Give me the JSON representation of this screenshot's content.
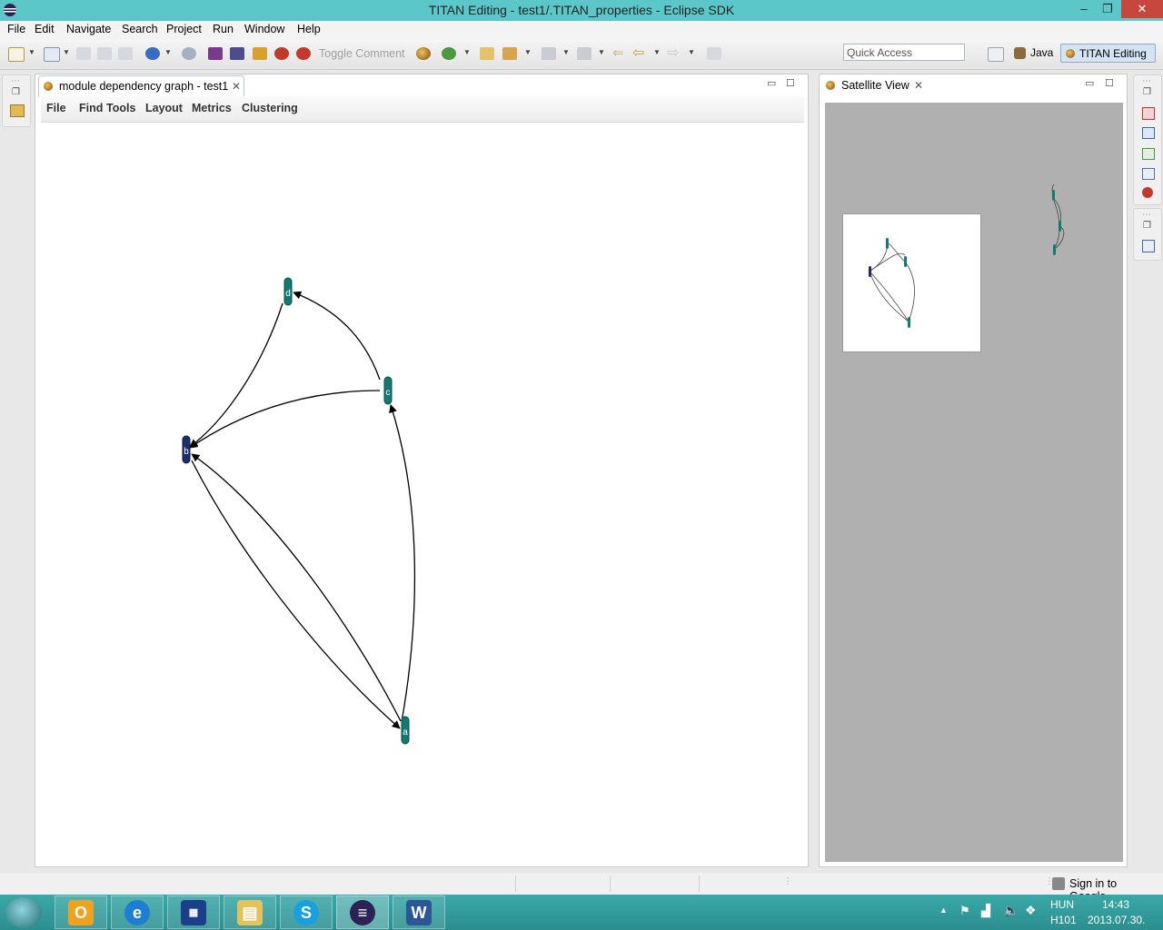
{
  "window": {
    "title": "TITAN Editing - test1/.TITAN_properties - Eclipse SDK",
    "minimize": "‒",
    "restore": "❐",
    "close": "✕"
  },
  "menubar": {
    "items": [
      "File",
      "Edit",
      "Navigate",
      "Search",
      "Project",
      "Run",
      "Window",
      "Help"
    ]
  },
  "toolbar": {
    "toggle_comment": "Toggle Comment",
    "quick_access_placeholder": "Quick Access",
    "perspectives": [
      "Java",
      "TITAN Editing"
    ]
  },
  "editor": {
    "tab_title": "module dependency graph - test1",
    "menu": [
      "File",
      "Find",
      "Tools",
      "Layout",
      "Metrics",
      "Clustering"
    ],
    "graph": {
      "nodes": [
        {
          "label": "d"
        },
        {
          "label": "c"
        },
        {
          "label": "b"
        },
        {
          "label": "a"
        }
      ],
      "edges": [
        {
          "from": "c",
          "to": "d"
        },
        {
          "from": "c",
          "to": "b"
        },
        {
          "from": "a",
          "to": "c"
        },
        {
          "from": "b",
          "to": "a"
        },
        {
          "from": "a",
          "to": "b"
        },
        {
          "from": "d",
          "to": "b"
        }
      ],
      "colors": {
        "node": "#137a72",
        "selected_node": "#1c2f6b",
        "edge": "#000000"
      }
    }
  },
  "satellite": {
    "tab_title": "Satellite View"
  },
  "statusbar": {
    "sign_in": "Sign in to Google..."
  },
  "taskbar": {
    "apps": [
      "outlook",
      "internet-explorer",
      "fcm",
      "file-explorer",
      "skype",
      "eclipse",
      "word"
    ],
    "tray": {
      "language": "HUN",
      "keyboard": "H101",
      "time": "14:43",
      "date": "2013.07.30."
    },
    "colors": {
      "taskbar": "#2c8e8f"
    }
  }
}
